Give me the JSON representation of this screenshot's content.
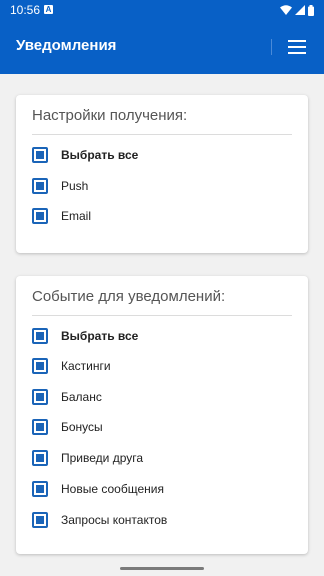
{
  "status_bar": {
    "time": "10:56",
    "notification_letter": "A"
  },
  "app_bar": {
    "title": "Уведомления"
  },
  "receive_settings": {
    "title": "Настройки получения:",
    "options": [
      {
        "label": "Выбрать все",
        "checked": true
      },
      {
        "label": "Push",
        "checked": true
      },
      {
        "label": "Email",
        "checked": true
      }
    ]
  },
  "notification_events": {
    "title": "Событие для уведомлений:",
    "options": [
      {
        "label": "Выбрать все",
        "checked": true
      },
      {
        "label": "Кастинги",
        "checked": true
      },
      {
        "label": "Баланс",
        "checked": true
      },
      {
        "label": "Бонусы",
        "checked": true
      },
      {
        "label": "Приведи друга",
        "checked": true
      },
      {
        "label": "Новые сообщения",
        "checked": true
      },
      {
        "label": "Запросы контактов",
        "checked": true
      }
    ]
  },
  "colors": {
    "primary": "#0860c6",
    "checkbox": "#1a64b8",
    "background": "#f1f1f1"
  }
}
